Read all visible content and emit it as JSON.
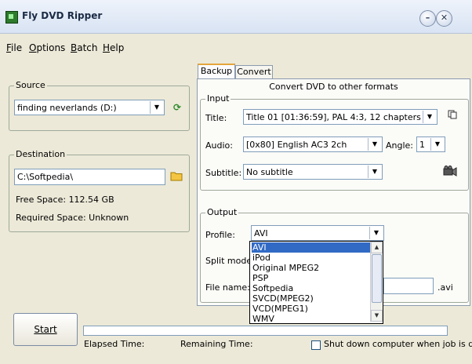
{
  "window": {
    "title": "Fly DVD Ripper"
  },
  "menu": [
    "File",
    "Options",
    "Batch",
    "Help"
  ],
  "source": {
    "label": "Source",
    "drive": "finding neverlands (D:)"
  },
  "destination": {
    "label": "Destination",
    "path": "C:\\Softpedia\\",
    "free_space": "Free Space: 112.54 GB",
    "required_space": "Required Space: Unknown"
  },
  "tabs": [
    "Backup",
    "Convert"
  ],
  "convert": {
    "heading": "Convert DVD to other formats",
    "input_label": "Input",
    "title_label": "Title:",
    "title_value": "Title 01 [01:36:59], PAL 4:3, 12 chapters",
    "audio_label": "Audio:",
    "audio_value": "[0x80] English AC3 2ch",
    "angle_label": "Angle:",
    "angle_value": "1",
    "subtitle_label": "Subtitle:",
    "subtitle_value": "No subtitle",
    "output_label": "Output",
    "profile_label": "Profile:",
    "profile_value": "AVI",
    "split_label": "Split mode:",
    "filename_label": "File name:",
    "filename_ext": ".avi",
    "profile_options": [
      "AVI",
      "iPod",
      "Original MPEG2",
      "PSP",
      "Softpedia",
      "SVCD(MPEG2)",
      "VCD(MPEG1)",
      "WMV"
    ],
    "selected_option": "AVI"
  },
  "bottom": {
    "start_label": "Start",
    "elapsed_label": "Elapsed Time:",
    "remaining_label": "Remaining Time:",
    "shutdown_label": "Shut down computer when job is done",
    "progress_fraction": 0
  },
  "icons": {
    "refresh": "refresh-icon",
    "folder": "folder-icon",
    "copy": "copy-icon",
    "camera": "camera-icon"
  },
  "colors": {
    "selection": "#316ac5",
    "active_tab_accent": "#e5a53a",
    "window_bg": "#ece9d8"
  }
}
